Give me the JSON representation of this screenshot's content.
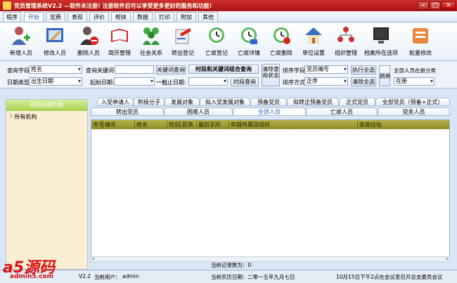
{
  "titlebar": {
    "title": "党员管理系统V2.2 —软件未注册! 注册软件后可以享受更多更好的服务和功能!"
  },
  "menu": [
    "程序",
    "开始",
    "党费",
    "表现",
    "评价",
    "帮扶",
    "数据",
    "打印",
    "附加",
    "其他"
  ],
  "toolbar": [
    "新增人员",
    "修改人员",
    "删除人员",
    "简历管理",
    "社会关系",
    "转出登记",
    "亡故登记",
    "亡故详情",
    "亡故删除",
    "单位设置",
    "组织管理",
    "档案所在选项",
    "批量修改"
  ],
  "query": {
    "field_label": "查询字段",
    "field_value": "姓名",
    "keyword_label": "查询关键词",
    "keyword_value": "",
    "keyword_btn": "关键词查询",
    "combo_btn": "时段和关键词组合查询",
    "date_type_label": "日期类型",
    "date_type_value": "出生日期",
    "start_label": "起始日期:",
    "start_value": "",
    "end_label": "一截止日期:",
    "end_value": "",
    "period_btn": "时段查询",
    "clear_btn": "清除查询状态",
    "sort_field_label": "排序字段",
    "sort_field_value": "党员编号",
    "sort_mode_label": "排序方式",
    "sort_mode_value": "正序",
    "exec_all": "执行全选",
    "clear_all": "清除全选",
    "refresh": "刷新",
    "all_class_label": "全部人员在册分类",
    "all_class_value": "在册"
  },
  "left": {
    "header": "组织机构列表",
    "tree_root": "所有机构"
  },
  "tabs_row1": [
    "入党申请人",
    "积极分子",
    "发展对象",
    "拟入党发展对象",
    "预备党员",
    "拟转正预备党员",
    "正式党员",
    "全部党员（预备+正式）"
  ],
  "tabs_row2": [
    "转出党员",
    "困难人员",
    "全部人员",
    "亡故人员",
    "党务人员"
  ],
  "active_tab": "全部人员",
  "grid": {
    "columns": [
      "序号",
      "编号",
      "姓名",
      "性别",
      "民族",
      "最后学历",
      "年龄",
      "所属党组织",
      "家庭住址"
    ]
  },
  "record_count": "当前记录数为：0",
  "status": {
    "version": "V2.2",
    "user_label": "当前用户：",
    "user": "admin",
    "lunar_label": "当前农历日期：",
    "lunar": "二零一五年九月七日",
    "notice": "10月15日下午2点在会议室召开总支委员会议"
  },
  "watermark": {
    "logo": "a5源码",
    "site": "admin5.com"
  },
  "colors": {
    "title": "#b81d1d",
    "grid_header": "#a4a13a",
    "left_header": "#a8d04e"
  }
}
